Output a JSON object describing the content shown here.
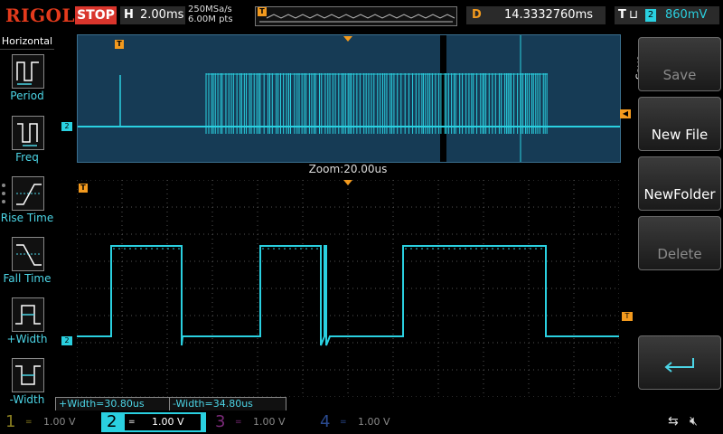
{
  "header": {
    "brand": "RIGOL",
    "run_state": "STOP",
    "h_label": "H",
    "timebase": "2.00ms",
    "sample_rate": "250MSa/s",
    "memory_depth": "6.00M pts",
    "delay_label": "D",
    "delay_value": "14.3332760ms",
    "trigger_label": "T",
    "trigger_shape": "⊔",
    "trigger_source": "2",
    "trigger_level": "860mV"
  },
  "left_menu": {
    "title": "Horizontal",
    "items": [
      {
        "label": "Period",
        "icon": "period-icon"
      },
      {
        "label": "Freq",
        "icon": "frequency-icon"
      },
      {
        "label": "Rise Time",
        "icon": "rise-time-icon"
      },
      {
        "label": "Fall Time",
        "icon": "fall-time-icon"
      },
      {
        "label": "+Width",
        "icon": "positive-width-icon"
      },
      {
        "label": "-Width",
        "icon": "negative-width-icon"
      }
    ]
  },
  "scope": {
    "zoom_label": "Zoom:20.00us",
    "channel_marker": "2",
    "trigger_marker": "T",
    "measurements": [
      {
        "label": "+Width=30.80us"
      },
      {
        "label": "-Width=34.80us"
      }
    ]
  },
  "right_menu": {
    "title": "Save",
    "buttons": [
      {
        "label": "Save",
        "enabled": false
      },
      {
        "label": "New File",
        "enabled": true
      },
      {
        "label": "NewFolder",
        "enabled": true
      },
      {
        "label": "Delete",
        "enabled": false
      },
      {
        "label": "",
        "icon": "enter-icon",
        "enabled": true
      }
    ]
  },
  "channels": [
    {
      "num": "1",
      "scale": "1.00 V",
      "coupling": "=",
      "active": false,
      "color": "#d4c62a"
    },
    {
      "num": "2",
      "scale": "1.00 V",
      "coupling": "=",
      "active": true,
      "color": "#2ad0e0"
    },
    {
      "num": "3",
      "scale": "1.00 V",
      "coupling": "=",
      "active": false,
      "color": "#d23ad0"
    },
    {
      "num": "4",
      "scale": "1.00 V",
      "coupling": "=",
      "active": false,
      "color": "#3a6ad0"
    }
  ],
  "status_icons": [
    "usb-icon",
    "speaker-mute-icon"
  ],
  "colors": {
    "trace": "#2ad0e0",
    "trigger": "#f39a1e",
    "stop": "#d9352c"
  }
}
